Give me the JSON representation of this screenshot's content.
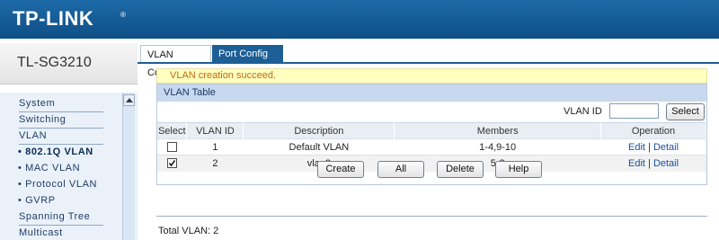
{
  "header": {
    "logo": "TP-LINK",
    "logo_tm": "®"
  },
  "sidebar": {
    "model": "TL-SG3210",
    "items": [
      {
        "label": "System"
      },
      {
        "label": "Switching"
      },
      {
        "label": "VLAN"
      },
      {
        "label": "• 802.1Q VLAN"
      },
      {
        "label": "• MAC VLAN"
      },
      {
        "label": "• Protocol VLAN"
      },
      {
        "label": "• GVRP"
      },
      {
        "label": "Spanning Tree"
      },
      {
        "label": "Multicast"
      }
    ]
  },
  "tabs": [
    {
      "label": "VLAN Config"
    },
    {
      "label": "Port Config"
    }
  ],
  "notice": "VLAN creation succeed.",
  "panel": {
    "title": "VLAN Table",
    "search_label": "VLAN ID",
    "search_value": "",
    "select_button": "Select"
  },
  "table": {
    "headers": [
      "Select",
      "VLAN ID",
      "Description",
      "Members",
      "Operation"
    ],
    "rows": [
      {
        "checked": false,
        "vlan_id": "1",
        "description": "Default VLAN",
        "members": "1-4,9-10",
        "edit": "Edit",
        "sep": "|",
        "detail": "Detail"
      },
      {
        "checked": true,
        "vlan_id": "2",
        "description": "vlan2",
        "members": "5-8",
        "edit": "Edit",
        "sep": "|",
        "detail": "Detail"
      }
    ]
  },
  "buttons": {
    "create": "Create",
    "all": "All",
    "delete": "Delete",
    "help": "Help"
  },
  "footer": {
    "total": "Total VLAN: 2"
  },
  "colors": {
    "header_blue": "#0f4f86",
    "notice_text": "#c06a10",
    "link": "#1b4fa1"
  }
}
